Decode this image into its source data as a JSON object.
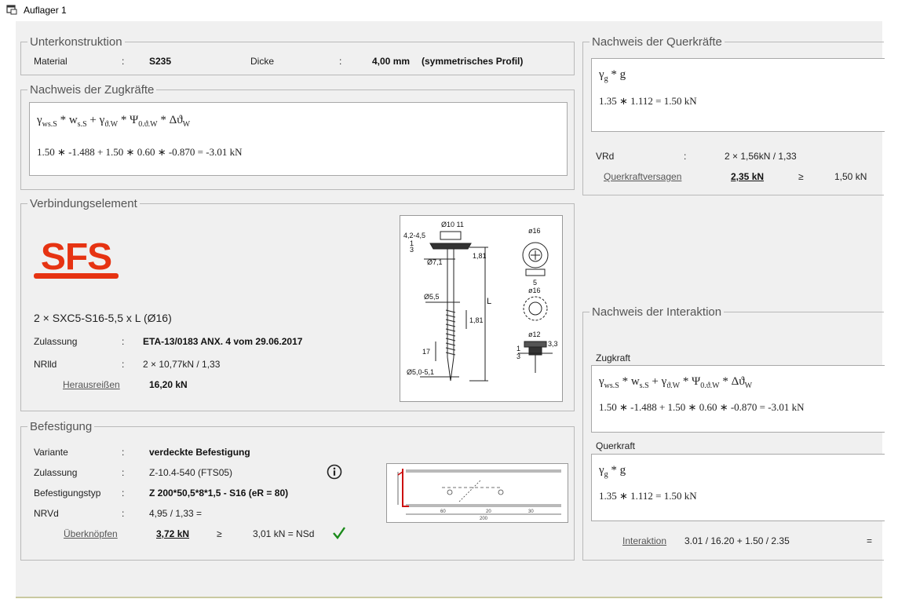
{
  "window": {
    "title": "Auflager 1"
  },
  "unterkonstruktion": {
    "title": "Unterkonstruktion",
    "material_label": "Material",
    "sep": ":",
    "material_value": "S235",
    "dicke_label": "Dicke",
    "dicke_value": "4,00 mm",
    "profil": "(symmetrisches Profil)"
  },
  "zug": {
    "title": "Nachweis der Zugkräfte",
    "formula": "γws.S * Ws.S + γϑ.W * Ψ0.ϑ.W * Δϑ",
    "calc": "1.50 ∗ -1.488 + 1.50 ∗ 0.60 ∗ -0.870 = -3.01 kN"
  },
  "verbindung": {
    "title": "Verbindungselement",
    "logo_text": "SFS",
    "product": "2 × SXC5-S16-5,5 x L (Ø16)",
    "zulassung_label": "Zulassung",
    "zulassung_value": "ETA-13/0183 ANX. 4  vom 29.06.2017",
    "nrlld_label": "NRlld",
    "nrlld_value": "2 × 10,77kN / 1,33",
    "heraus_label": "Herausreißen",
    "heraus_value": "16,20 kN",
    "drawing_labels": [
      "Ø10 11",
      "4,2-4,5",
      "1",
      "3",
      "Ø7,1",
      "1,81",
      "L",
      "Ø5,5",
      "1,81",
      "17",
      "Ø5,0-5,1",
      "ø16",
      "5",
      "ø16",
      "ø12",
      "1",
      "3",
      "3,3"
    ]
  },
  "befestigung": {
    "title": "Befestigung",
    "variante_label": "Variante",
    "variante_value": "verdeckte Befestigung",
    "zulassung_label": "Zulassung",
    "zulassung_value": "Z-10.4-540 (FTS05)",
    "typ_label": "Befestigungstyp",
    "typ_value": "Z 200*50,5*8*1,5 - S16 (eR = 80)",
    "nrvd_label": "NRVd",
    "nrvd_value": "4,95 / 1,33 =",
    "ueber_label": "Überknöpfen",
    "ueber_value": "3,72 kN",
    "geq": "≥",
    "nsd_value": "3,01 kN  = NSd",
    "drawing_labels": [
      "60",
      "20",
      "30",
      "200"
    ]
  },
  "quer": {
    "title": "Nachweis der Querkräfte",
    "formula": "γg * g",
    "calc": "1.35 ∗ 1.112 = 1.50 kN",
    "vrd_label": "VRd",
    "vrd_value": "2 × 1,56kN / 1,33",
    "versagen_label": "Querkraftversagen",
    "versagen_value": "2,35 kN",
    "geq": "≥",
    "compare_value": "1,50 kN"
  },
  "interaktion": {
    "title": "Nachweis der Interaktion",
    "zug_label": "Zugkraft",
    "zug_formula": "γws.S * Ws.S + γϑ.W * Ψ0.ϑ.W * Δϑ",
    "zug_calc": "1.50 ∗ -1.488 + 1.50 ∗ 0.60 ∗ -0.870 = -3.01 kN",
    "quer_label": "Querkraft",
    "quer_formula": "γg * g",
    "quer_calc": "1.35 ∗ 1.112 = 1.50 kN",
    "label": "Interaktion",
    "value": "3.01 / 16.20  +  1.50 / 2.35",
    "eq": "="
  },
  "colors": {
    "sfs_red": "#e63312",
    "check_green": "#1a8a1a",
    "panel_bg": "#f0f0f0"
  }
}
